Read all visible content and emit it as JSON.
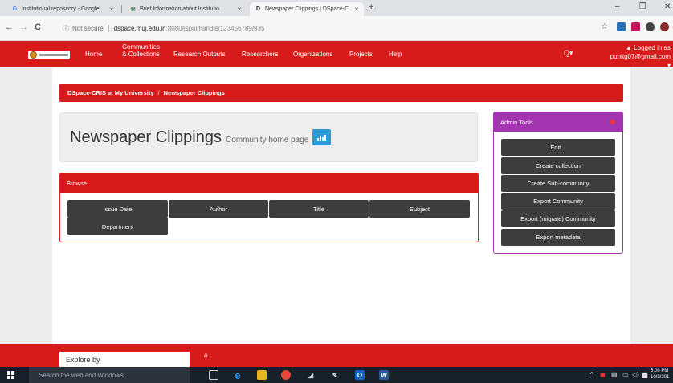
{
  "browser": {
    "tabs": [
      {
        "label": "institutional repository - Google",
        "favicon": "G",
        "favicon_color": "#4285f4"
      },
      {
        "label": "Brief Information about Institutio",
        "favicon": "✉",
        "favicon_color": "#2b7a3f"
      },
      {
        "label": "Newspaper Clippings | DSpace-C",
        "favicon": "D",
        "favicon_color": "#222"
      }
    ],
    "new_tab": "+",
    "minimize": "–",
    "maximize": "❐",
    "close": "✕",
    "back": "←",
    "forward": "→",
    "reload": "C",
    "info_icon": "ⓘ",
    "not_secure": "Not secure",
    "url_host": "dspace.muj.edu.in",
    "url_path": ":8080/jspui/handle/123456789/935",
    "star": "☆"
  },
  "site": {
    "nav": [
      {
        "label": "Home"
      },
      {
        "label": "Communities\n& Collections"
      },
      {
        "label": "Research Outputs"
      },
      {
        "label": "Researchers"
      },
      {
        "label": "Organizations"
      },
      {
        "label": "Projects"
      },
      {
        "label": "Help"
      }
    ],
    "search_icon": "Q▾",
    "login_line1": "Logged in as",
    "login_line2": "punitg07@gmail.com ▾",
    "login_icon": "👤"
  },
  "breadcrumb": {
    "root": "DSpace-CRIS at My University",
    "sep": "/",
    "current": "Newspaper Clippings"
  },
  "community": {
    "title": "Newspaper Clippings",
    "subtitle": "Community home page"
  },
  "browse": {
    "header": "Browse",
    "buttons": [
      "Issue Date",
      "Author",
      "Title",
      "Subject",
      "Department"
    ]
  },
  "admin": {
    "header": "Admin Tools",
    "buttons": [
      "Edit...",
      "Create collection",
      "Create Sub-community",
      "Export Community",
      "Export (migrate) Community",
      "Export metadata"
    ]
  },
  "footer": {
    "explore": "Explore by",
    "a": "a"
  },
  "taskbar": {
    "search": "Search the web and Windows",
    "time": "5:00 PM",
    "date": "10/3/201"
  },
  "colors": {
    "brand_red": "#d71b1b",
    "admin_purple": "#a435b1",
    "button_dark": "#3d3d3d",
    "stats_blue": "#2a9bd7"
  }
}
